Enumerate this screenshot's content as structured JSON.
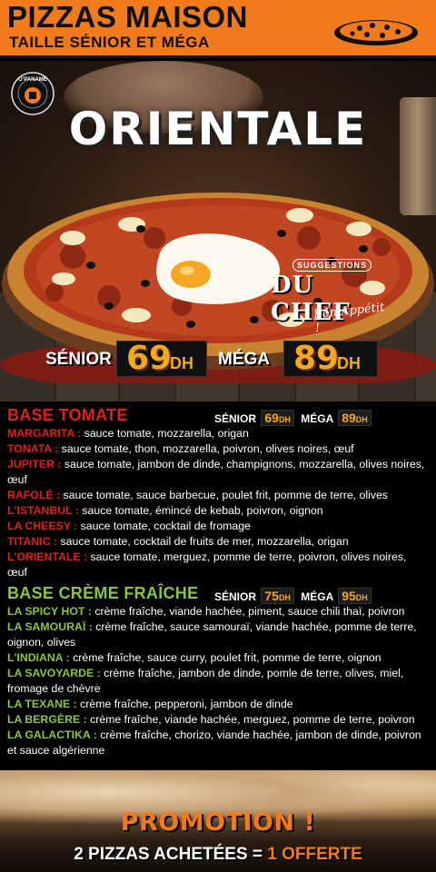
{
  "header": {
    "title": "PIZZAS MAISON",
    "subtitle": "TAILLE SÉNIOR ET MÉGA",
    "pizza_icon": "pizza-icon"
  },
  "hero": {
    "logo_icon": "opaname-logo",
    "logo_text": "O'PANAME",
    "pizza_name": "ORIENTALE",
    "badge": {
      "suggestions": "SUGGESTIONS",
      "du_chef": "DU CHEF",
      "bon_appetit": "Bon Appétit !"
    },
    "prices": {
      "senior_label": "SÉNIOR",
      "senior_price": "69",
      "mega_label": "MÉGA",
      "mega_price": "89",
      "currency": "DH"
    }
  },
  "sections": [
    {
      "title": "BASE TOMATE",
      "senior_label": "SÉNIOR",
      "senior_price": "69",
      "mega_label": "MÉGA",
      "mega_price": "89",
      "currency": "DH",
      "items": [
        {
          "name": "MARGARITA :",
          "desc": " sauce tomate, mozzarella, origan"
        },
        {
          "name": "TONATA :",
          "desc": "  sauce tomate, thon, mozzarella, poivron, olives noires, œuf"
        },
        {
          "name": "JUPITER :",
          "desc": " sauce tomate, jambon de dinde, champignons, mozzarella, olives noires, œuf"
        },
        {
          "name": "RAFOLÉ :",
          "desc": " sauce tomate, sauce barbecue, poulet frit, pomme de terre, olives"
        },
        {
          "name": "L'ISTANBUL :",
          "desc": " sauce tomate, émincé de kebab, poivron, oignon"
        },
        {
          "name": "LA CHEESY :",
          "desc": "  sauce tomate, cocktail de fromage"
        },
        {
          "name": "TITANIC :",
          "desc": " sauce tomate, cocktail de fruits de mer, mozzarella, origan"
        },
        {
          "name": "L'ORIENTALE :",
          "desc": " sauce tomate, merguez, pomme de terre, poivron, olives noires, œuf"
        }
      ]
    },
    {
      "title": "BASE CRÈME FRAÎCHE",
      "senior_label": "SÉNIOR",
      "senior_price": "75",
      "mega_label": "MÉGA",
      "mega_price": "95",
      "currency": "DH",
      "items": [
        {
          "name": "LA SPICY HOT :",
          "desc": " crème fraîche, viande hachée, piment, sauce chili thaï, poivron"
        },
        {
          "name": "LA SAMOURAÏ :",
          "desc": "  crème fraîche, sauce samouraï, viande hachée, pomme de terre, oignon, olives"
        },
        {
          "name": "L'INDIANA :",
          "desc": " crème fraîche, sauce curry, poulet frit, pomme de terre, oignon"
        },
        {
          "name": "LA SAVOYARDE :",
          "desc": " crème fraîche, jambon de dinde, pomle de terre, olives, miel, fromage de chèvre"
        },
        {
          "name": "LA TEXANE :",
          "desc": " crème fraîche, pepperoni, jambon de dinde"
        },
        {
          "name": "LA BERGÈRE :",
          "desc": " crème fraîche, viande hachée, merguez, pomme de terre, poivron"
        },
        {
          "name": "LA GALACTIKA :",
          "desc": " crème fraîche, chorizo, viande hachée, jambon de dinde, poivron et sauce algérienne"
        }
      ]
    }
  ],
  "promo": {
    "title": "PROMOTION !",
    "line_a": "2 PIZZAS ACHETÉES",
    "line_eq": " = ",
    "line_b": "1 OFFERTE"
  },
  "colors": {
    "header_orange": "#f07a1c",
    "price_gold": "#f5a623",
    "tomato_red": "#e0201a",
    "creme_green": "#8cc63f"
  }
}
